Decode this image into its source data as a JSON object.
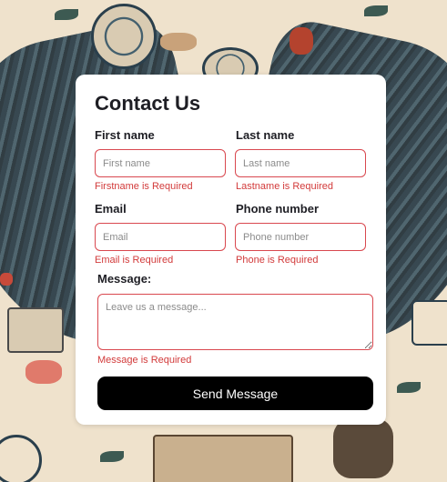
{
  "form": {
    "title": "Contact Us",
    "first_name": {
      "label": "First name",
      "placeholder": "First name",
      "error": "Firstname is Required"
    },
    "last_name": {
      "label": "Last name",
      "placeholder": "Last name",
      "error": "Lastname is Required"
    },
    "email": {
      "label": "Email",
      "placeholder": "Email",
      "error": "Email is Required"
    },
    "phone": {
      "label": "Phone number",
      "placeholder": "Phone number",
      "error": "Phone is Required"
    },
    "message": {
      "label": "Message:",
      "placeholder": "Leave us a message...",
      "error": "Message is Required"
    },
    "submit_label": "Send Message"
  },
  "colors": {
    "error": "#d23a3a",
    "button": "#000000",
    "card": "#ffffff"
  }
}
